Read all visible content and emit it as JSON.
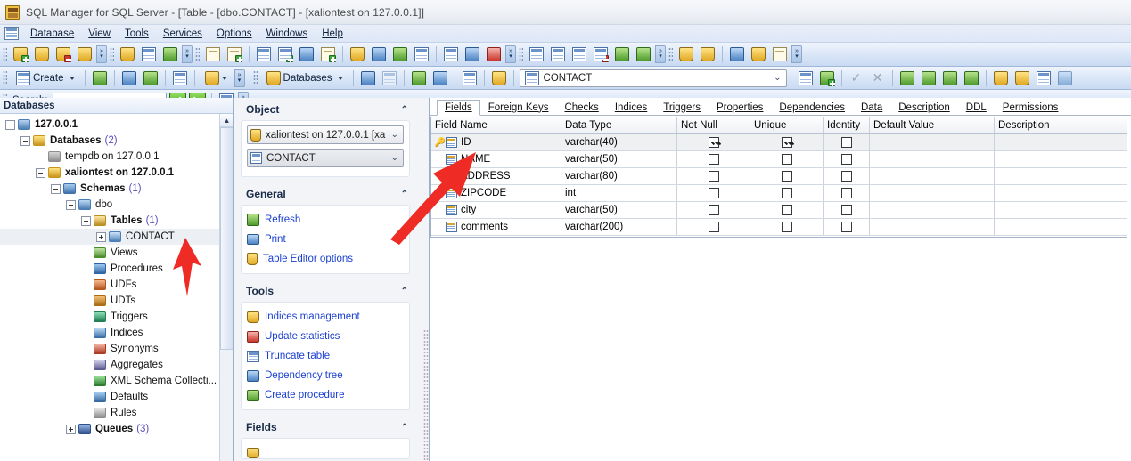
{
  "window": {
    "title": "SQL Manager for SQL Server - [Table - [dbo.CONTACT] - [xaliontest on 127.0.0.1]]",
    "app_icon": "app-icon"
  },
  "menubar": {
    "items": [
      {
        "label": "Database"
      },
      {
        "label": "View"
      },
      {
        "label": "Tools"
      },
      {
        "label": "Services"
      },
      {
        "label": "Options"
      },
      {
        "label": "Windows"
      },
      {
        "label": "Help"
      }
    ]
  },
  "toolbar_object": {
    "create_label": "Create",
    "search_label": "Search:",
    "search_value": "",
    "search_placeholder": ""
  },
  "toolbar_editor": {
    "databases_label": "Databases",
    "object_name": "CONTACT"
  },
  "left_panel": {
    "header": "Databases",
    "tree": [
      {
        "label": "127.0.0.1",
        "count": "",
        "depth": 0,
        "toggle": "minus",
        "icon": "server-icon",
        "bold": true
      },
      {
        "label": "Databases",
        "count": "(2)",
        "depth": 1,
        "toggle": "minus",
        "icon": "databases-folder-icon",
        "bold": true
      },
      {
        "label": "tempdb on 127.0.0.1",
        "count": "",
        "depth": 2,
        "toggle": "none",
        "icon": "database-gray-icon",
        "bold": false
      },
      {
        "label": "xaliontest on 127.0.0.1",
        "count": "",
        "depth": 2,
        "toggle": "minus",
        "icon": "database-icon",
        "bold": true
      },
      {
        "label": "Schemas",
        "count": "(1)",
        "depth": 3,
        "toggle": "minus",
        "icon": "schemas-icon",
        "bold": true
      },
      {
        "label": "dbo",
        "count": "",
        "depth": 4,
        "toggle": "minus",
        "icon": "schema-icon",
        "bold": false
      },
      {
        "label": "Tables",
        "count": "(1)",
        "depth": 5,
        "toggle": "minus",
        "icon": "tables-icon",
        "bold": true
      },
      {
        "label": "CONTACT",
        "count": "",
        "depth": 6,
        "toggle": "plus",
        "icon": "table-icon",
        "bold": false,
        "selected": true
      },
      {
        "label": "Views",
        "count": "",
        "depth": 5,
        "toggle": "none",
        "icon": "views-icon",
        "bold": false
      },
      {
        "label": "Procedures",
        "count": "",
        "depth": 5,
        "toggle": "none",
        "icon": "procedures-icon",
        "bold": false
      },
      {
        "label": "UDFs",
        "count": "",
        "depth": 5,
        "toggle": "none",
        "icon": "udfs-icon",
        "bold": false
      },
      {
        "label": "UDTs",
        "count": "",
        "depth": 5,
        "toggle": "none",
        "icon": "udts-icon",
        "bold": false
      },
      {
        "label": "Triggers",
        "count": "",
        "depth": 5,
        "toggle": "none",
        "icon": "triggers-icon",
        "bold": false
      },
      {
        "label": "Indices",
        "count": "",
        "depth": 5,
        "toggle": "none",
        "icon": "indices-icon",
        "bold": false
      },
      {
        "label": "Synonyms",
        "count": "",
        "depth": 5,
        "toggle": "none",
        "icon": "synonyms-icon",
        "bold": false
      },
      {
        "label": "Aggregates",
        "count": "",
        "depth": 5,
        "toggle": "none",
        "icon": "aggregates-icon",
        "bold": false
      },
      {
        "label": "XML Schema Collecti...",
        "count": "",
        "depth": 5,
        "toggle": "none",
        "icon": "xml-schema-icon",
        "bold": false
      },
      {
        "label": "Defaults",
        "count": "",
        "depth": 5,
        "toggle": "none",
        "icon": "defaults-icon",
        "bold": false
      },
      {
        "label": "Rules",
        "count": "",
        "depth": 5,
        "toggle": "none",
        "icon": "rules-icon",
        "bold": false
      },
      {
        "label": "Queues",
        "count": "(3)",
        "depth": 4,
        "toggle": "plus",
        "icon": "queues-icon",
        "bold": true
      }
    ]
  },
  "object_panel": {
    "sections": {
      "object": {
        "title": "Object",
        "database_combo": "xaliontest on 127.0.0.1 [xa",
        "table_combo": "CONTACT"
      },
      "general": {
        "title": "General",
        "links": [
          {
            "label": "Refresh",
            "icon": "refresh-icon"
          },
          {
            "label": "Print",
            "icon": "printer-icon"
          },
          {
            "label": "Table Editor options",
            "icon": "options-icon"
          }
        ]
      },
      "tools": {
        "title": "Tools",
        "links": [
          {
            "label": "Indices management",
            "icon": "indices-management-icon"
          },
          {
            "label": "Update statistics",
            "icon": "update-statistics-icon"
          },
          {
            "label": "Truncate table",
            "icon": "truncate-table-icon"
          },
          {
            "label": "Dependency tree",
            "icon": "dependency-tree-icon"
          },
          {
            "label": "Create procedure",
            "icon": "create-procedure-icon"
          }
        ]
      },
      "fields": {
        "title": "Fields"
      }
    }
  },
  "main": {
    "tabs": [
      {
        "label": "Fields",
        "active": true
      },
      {
        "label": "Foreign Keys",
        "active": false
      },
      {
        "label": "Checks",
        "active": false
      },
      {
        "label": "Indices",
        "active": false
      },
      {
        "label": "Triggers",
        "active": false
      },
      {
        "label": "Properties",
        "active": false
      },
      {
        "label": "Dependencies",
        "active": false
      },
      {
        "label": "Data",
        "active": false
      },
      {
        "label": "Description",
        "active": false
      },
      {
        "label": "DDL",
        "active": false
      },
      {
        "label": "Permissions",
        "active": false
      }
    ],
    "grid": {
      "columns": [
        "Field Name",
        "Data Type",
        "Not Null",
        "Unique",
        "Identity",
        "Default Value",
        "Description"
      ],
      "rows": [
        {
          "primary_key": true,
          "selected": true,
          "field_name": "ID",
          "data_type": "varchar(40)",
          "not_null": true,
          "unique": true,
          "identity": false,
          "default_value": "",
          "description": ""
        },
        {
          "primary_key": false,
          "selected": false,
          "field_name": "NAME",
          "data_type": "varchar(50)",
          "not_null": false,
          "unique": false,
          "identity": false,
          "default_value": "",
          "description": ""
        },
        {
          "primary_key": false,
          "selected": false,
          "field_name": "ADDRESS",
          "data_type": "varchar(80)",
          "not_null": false,
          "unique": false,
          "identity": false,
          "default_value": "",
          "description": ""
        },
        {
          "primary_key": false,
          "selected": false,
          "field_name": "ZIPCODE",
          "data_type": "int",
          "not_null": false,
          "unique": false,
          "identity": false,
          "default_value": "",
          "description": ""
        },
        {
          "primary_key": false,
          "selected": false,
          "field_name": "city",
          "data_type": "varchar(50)",
          "not_null": false,
          "unique": false,
          "identity": false,
          "default_value": "",
          "description": ""
        },
        {
          "primary_key": false,
          "selected": false,
          "field_name": "comments",
          "data_type": "varchar(200)",
          "not_null": false,
          "unique": false,
          "identity": false,
          "default_value": "",
          "description": ""
        }
      ]
    }
  },
  "annotations": {
    "arrow_color": "#ee2b24",
    "arrows": [
      {
        "name": "arrow-to-object-combo"
      },
      {
        "name": "arrow-to-contact-node"
      }
    ]
  },
  "colors": {
    "accent": "#1a3fd0",
    "toolbar_blue": "#c9daf2",
    "title_bg": "#eef1f6",
    "selection": "#eceff3"
  }
}
